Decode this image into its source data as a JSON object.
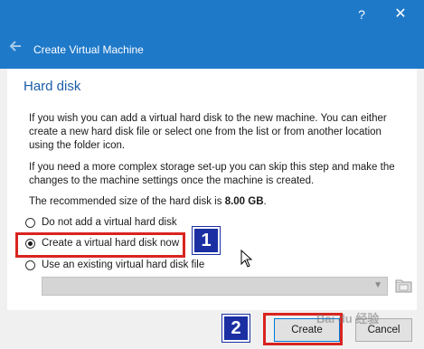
{
  "titlebar": {
    "help": "?",
    "close": "✕",
    "bg": "#1f79c9"
  },
  "header": {
    "back_icon": "back-arrow-icon",
    "title": "Create Virtual Machine"
  },
  "page": {
    "title": "Hard disk",
    "para1": "If you wish you can add a virtual hard disk to the new machine. You can either create a new hard disk file or select one from the list or from another location using the folder icon.",
    "para2": "If you need a more complex storage set-up you can skip this step and make the changes to the machine settings once the machine is created.",
    "para3_prefix": "The recommended size of the hard disk is ",
    "para3_value": "8.00 GB",
    "para3_suffix": "."
  },
  "options": [
    {
      "label": "Do not add a virtual hard disk",
      "checked": false
    },
    {
      "label": "Create a virtual hard disk now",
      "checked": true
    },
    {
      "label": "Use an existing virtual hard disk file",
      "checked": false
    }
  ],
  "disk_selector": {
    "value": "",
    "enabled": false
  },
  "annotations": {
    "badge1": "1",
    "badge2": "2",
    "highlight_color": "#d9241f",
    "badge_color": "#1b2fa3"
  },
  "buttons": {
    "create": "Create",
    "cancel": "Cancel"
  },
  "watermark": "Bai du 经验"
}
